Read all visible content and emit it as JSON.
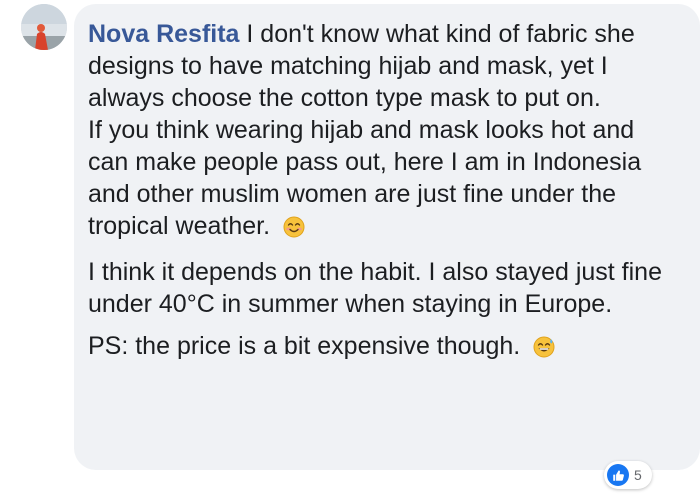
{
  "comment": {
    "author": "Nova Resfita",
    "paragraphs": [
      {
        "lines": [
          "I don't know what kind of fabric she designs to have matching hijab and mask, yet I always choose the cotton type mask to put on.",
          "If you think wearing hijab and mask looks hot and can make people pass out, here I am in Indonesia and other muslim women are just fine under the tropical weather."
        ],
        "emoji": "smiling-face-emoji"
      },
      {
        "text": "I think it depends on the habit. I also stayed just fine under 40°C in summer when staying in Europe."
      },
      {
        "text": "PS: the price is a bit expensive though.",
        "emoji": "grinning-sweat-emoji"
      }
    ],
    "reactions": {
      "icon": "like-icon",
      "count": "5",
      "color": "#1877f2"
    }
  },
  "colors": {
    "bubble": "#f0f2f5",
    "author": "#385898",
    "text": "#1c1e21"
  }
}
